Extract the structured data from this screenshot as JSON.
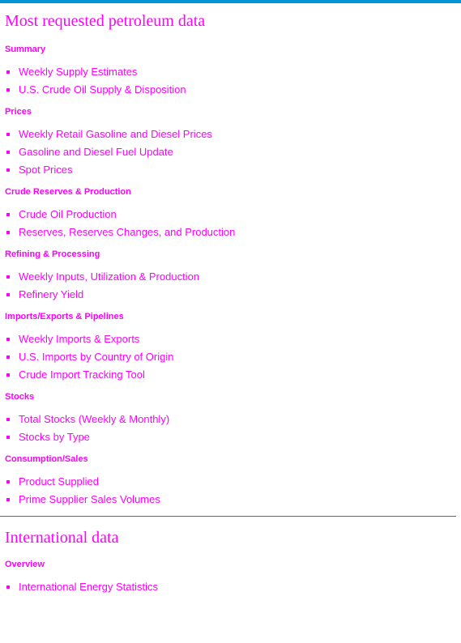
{
  "page_title": "Most requested petroleum data",
  "sections": [
    {
      "title": "Summary",
      "links": [
        "Weekly Supply Estimates",
        "U.S. Crude Oil Supply & Disposition"
      ]
    },
    {
      "title": "Prices",
      "links": [
        "Weekly Retail Gasoline and Diesel Prices",
        "Gasoline and Diesel Fuel Update",
        "Spot Prices"
      ]
    },
    {
      "title": "Crude Reserves & Production",
      "links": [
        "Crude Oil Production",
        "Reserves, Reserves Changes, and Production"
      ]
    },
    {
      "title": "Refining & Processing",
      "links": [
        "Weekly Inputs, Utilization & Production",
        "Refinery Yield"
      ]
    },
    {
      "title": "Imports/Exports & Pipelines",
      "links": [
        "Weekly Imports & Exports",
        "U.S. Imports by Country of Origin",
        "Crude Import Tracking Tool"
      ]
    },
    {
      "title": "Stocks",
      "links": [
        "Total Stocks (Weekly & Monthly)",
        "Stocks by Type"
      ]
    },
    {
      "title": "Consumption/Sales",
      "links": [
        "Product Supplied",
        "Prime Supplier Sales Volumes"
      ]
    }
  ],
  "international": {
    "title": "International data",
    "sections": [
      {
        "title": "Overview",
        "links": [
          "International Energy Statistics"
        ]
      }
    ]
  },
  "colors": {
    "accent_bar": "#0096d6",
    "text": "#ff00ff"
  }
}
